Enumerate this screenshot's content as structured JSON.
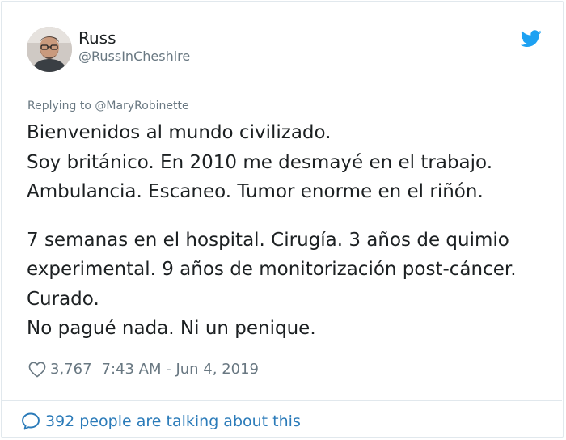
{
  "author": {
    "name": "Russ",
    "handle": "@RussInCheshire"
  },
  "reply": {
    "label": "Replying to ",
    "target": "@MaryRobinette"
  },
  "tweet": {
    "lines": [
      "Bienvenidos al mundo civilizado.",
      "Soy británico. En 2010 me desmayé en el trabajo.",
      "Ambulancia. Escaneo. Tumor enorme en el riñón.",
      "7 semanas en el hospital. Cirugía. 3 años de quimio",
      "experimental. 9 años de monitorización post-cáncer.",
      "Curado.",
      "No pagué nada. Ni un penique."
    ]
  },
  "meta": {
    "likes": "3,767",
    "timestamp": "7:43 AM - Jun 4, 2019"
  },
  "footer": {
    "talking": "392 people are talking about this"
  },
  "icons": {
    "brand": "twitter-bird-icon",
    "like": "heart-icon",
    "conversation": "speech-bubble-icon"
  },
  "colors": {
    "twitter_blue": "#1da1f2",
    "link_blue": "#2b7bb9",
    "muted_gray": "#697882",
    "text": "#1c2022",
    "border": "#e1e8ed"
  }
}
